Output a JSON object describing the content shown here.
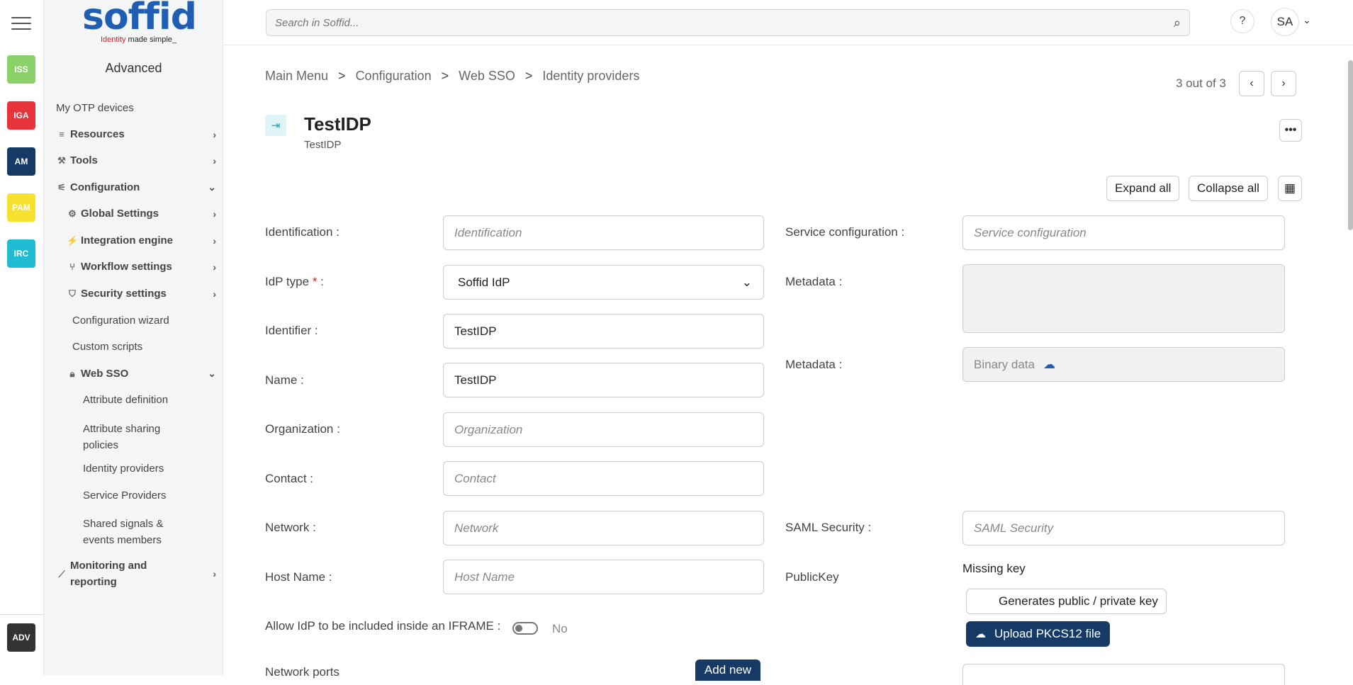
{
  "rail": {
    "apps": [
      {
        "label": "ISS",
        "color": "#8bd16a"
      },
      {
        "label": "IGA",
        "color": "#e8323c"
      },
      {
        "label": "AM",
        "color": "#153a66"
      },
      {
        "label": "PAM",
        "color": "#f5e12e"
      },
      {
        "label": "IRC",
        "color": "#1fbcd4"
      }
    ],
    "bottom": {
      "label": "ADV",
      "color": "#333333"
    }
  },
  "logo": {
    "word": "soffid",
    "tag_a": "Identity",
    "tag_b": " made simple_"
  },
  "sidebar": {
    "title": "Advanced",
    "items": [
      {
        "label": "My OTP devices"
      },
      {
        "label": "Resources"
      },
      {
        "label": "Tools"
      },
      {
        "label": "Configuration"
      },
      {
        "label": "Global Settings"
      },
      {
        "label": "Integration engine"
      },
      {
        "label": "Workflow settings"
      },
      {
        "label": "Security settings"
      },
      {
        "label": "Configuration wizard"
      },
      {
        "label": "Custom scripts"
      },
      {
        "label": "Web SSO"
      },
      {
        "label": "Attribute definition"
      },
      {
        "label": "Attribute sharing policies"
      },
      {
        "label": "Identity providers"
      },
      {
        "label": "Service Providers"
      },
      {
        "label": "Shared signals & events members"
      },
      {
        "label": "Monitoring and reporting"
      }
    ]
  },
  "search": {
    "placeholder": "Search in Soffid..."
  },
  "user": {
    "initials": "SA",
    "help": "?"
  },
  "breadcrumb": {
    "items": [
      "Main Menu",
      "Configuration",
      "Web SSO",
      "Identity providers"
    ],
    "sep": ">"
  },
  "pager": {
    "text": "3 out of 3"
  },
  "record": {
    "title": "TestIDP",
    "subtitle": "TestIDP"
  },
  "toolbar": {
    "expand_all": "Expand all",
    "collapse_all": "Collapse all"
  },
  "form": {
    "identification": {
      "label": "Identification :",
      "placeholder": "Identification",
      "value": ""
    },
    "idp_type": {
      "label": "IdP type",
      "req": "*",
      "suffix": " :",
      "value": "Soffid IdP"
    },
    "identifier": {
      "label": "Identifier :",
      "value": "TestIDP"
    },
    "name": {
      "label": "Name :",
      "value": "TestIDP"
    },
    "organization": {
      "label": "Organization :",
      "placeholder": "Organization"
    },
    "contact": {
      "label": "Contact :",
      "placeholder": "Contact"
    },
    "network": {
      "label": "Network :",
      "placeholder": "Network"
    },
    "host_name": {
      "label": "Host Name :",
      "placeholder": "Host Name"
    },
    "iframe": {
      "label": "Allow IdP to be included inside an IFRAME :",
      "value": "No"
    },
    "network_ports": {
      "label": "Network ports",
      "add_new": "Add new"
    },
    "service_config": {
      "label": "Service configuration :",
      "placeholder": "Service configuration"
    },
    "metadata_text": {
      "label": "Metadata :"
    },
    "metadata_bin": {
      "label": "Metadata :",
      "value": "Binary data"
    },
    "saml_security": {
      "label": "SAML Security :",
      "placeholder": "SAML Security"
    },
    "public_key": {
      "label": "PublicKey",
      "status": "Missing key",
      "generate": "Generates public / private key",
      "upload": "Upload PKCS12 file"
    }
  }
}
